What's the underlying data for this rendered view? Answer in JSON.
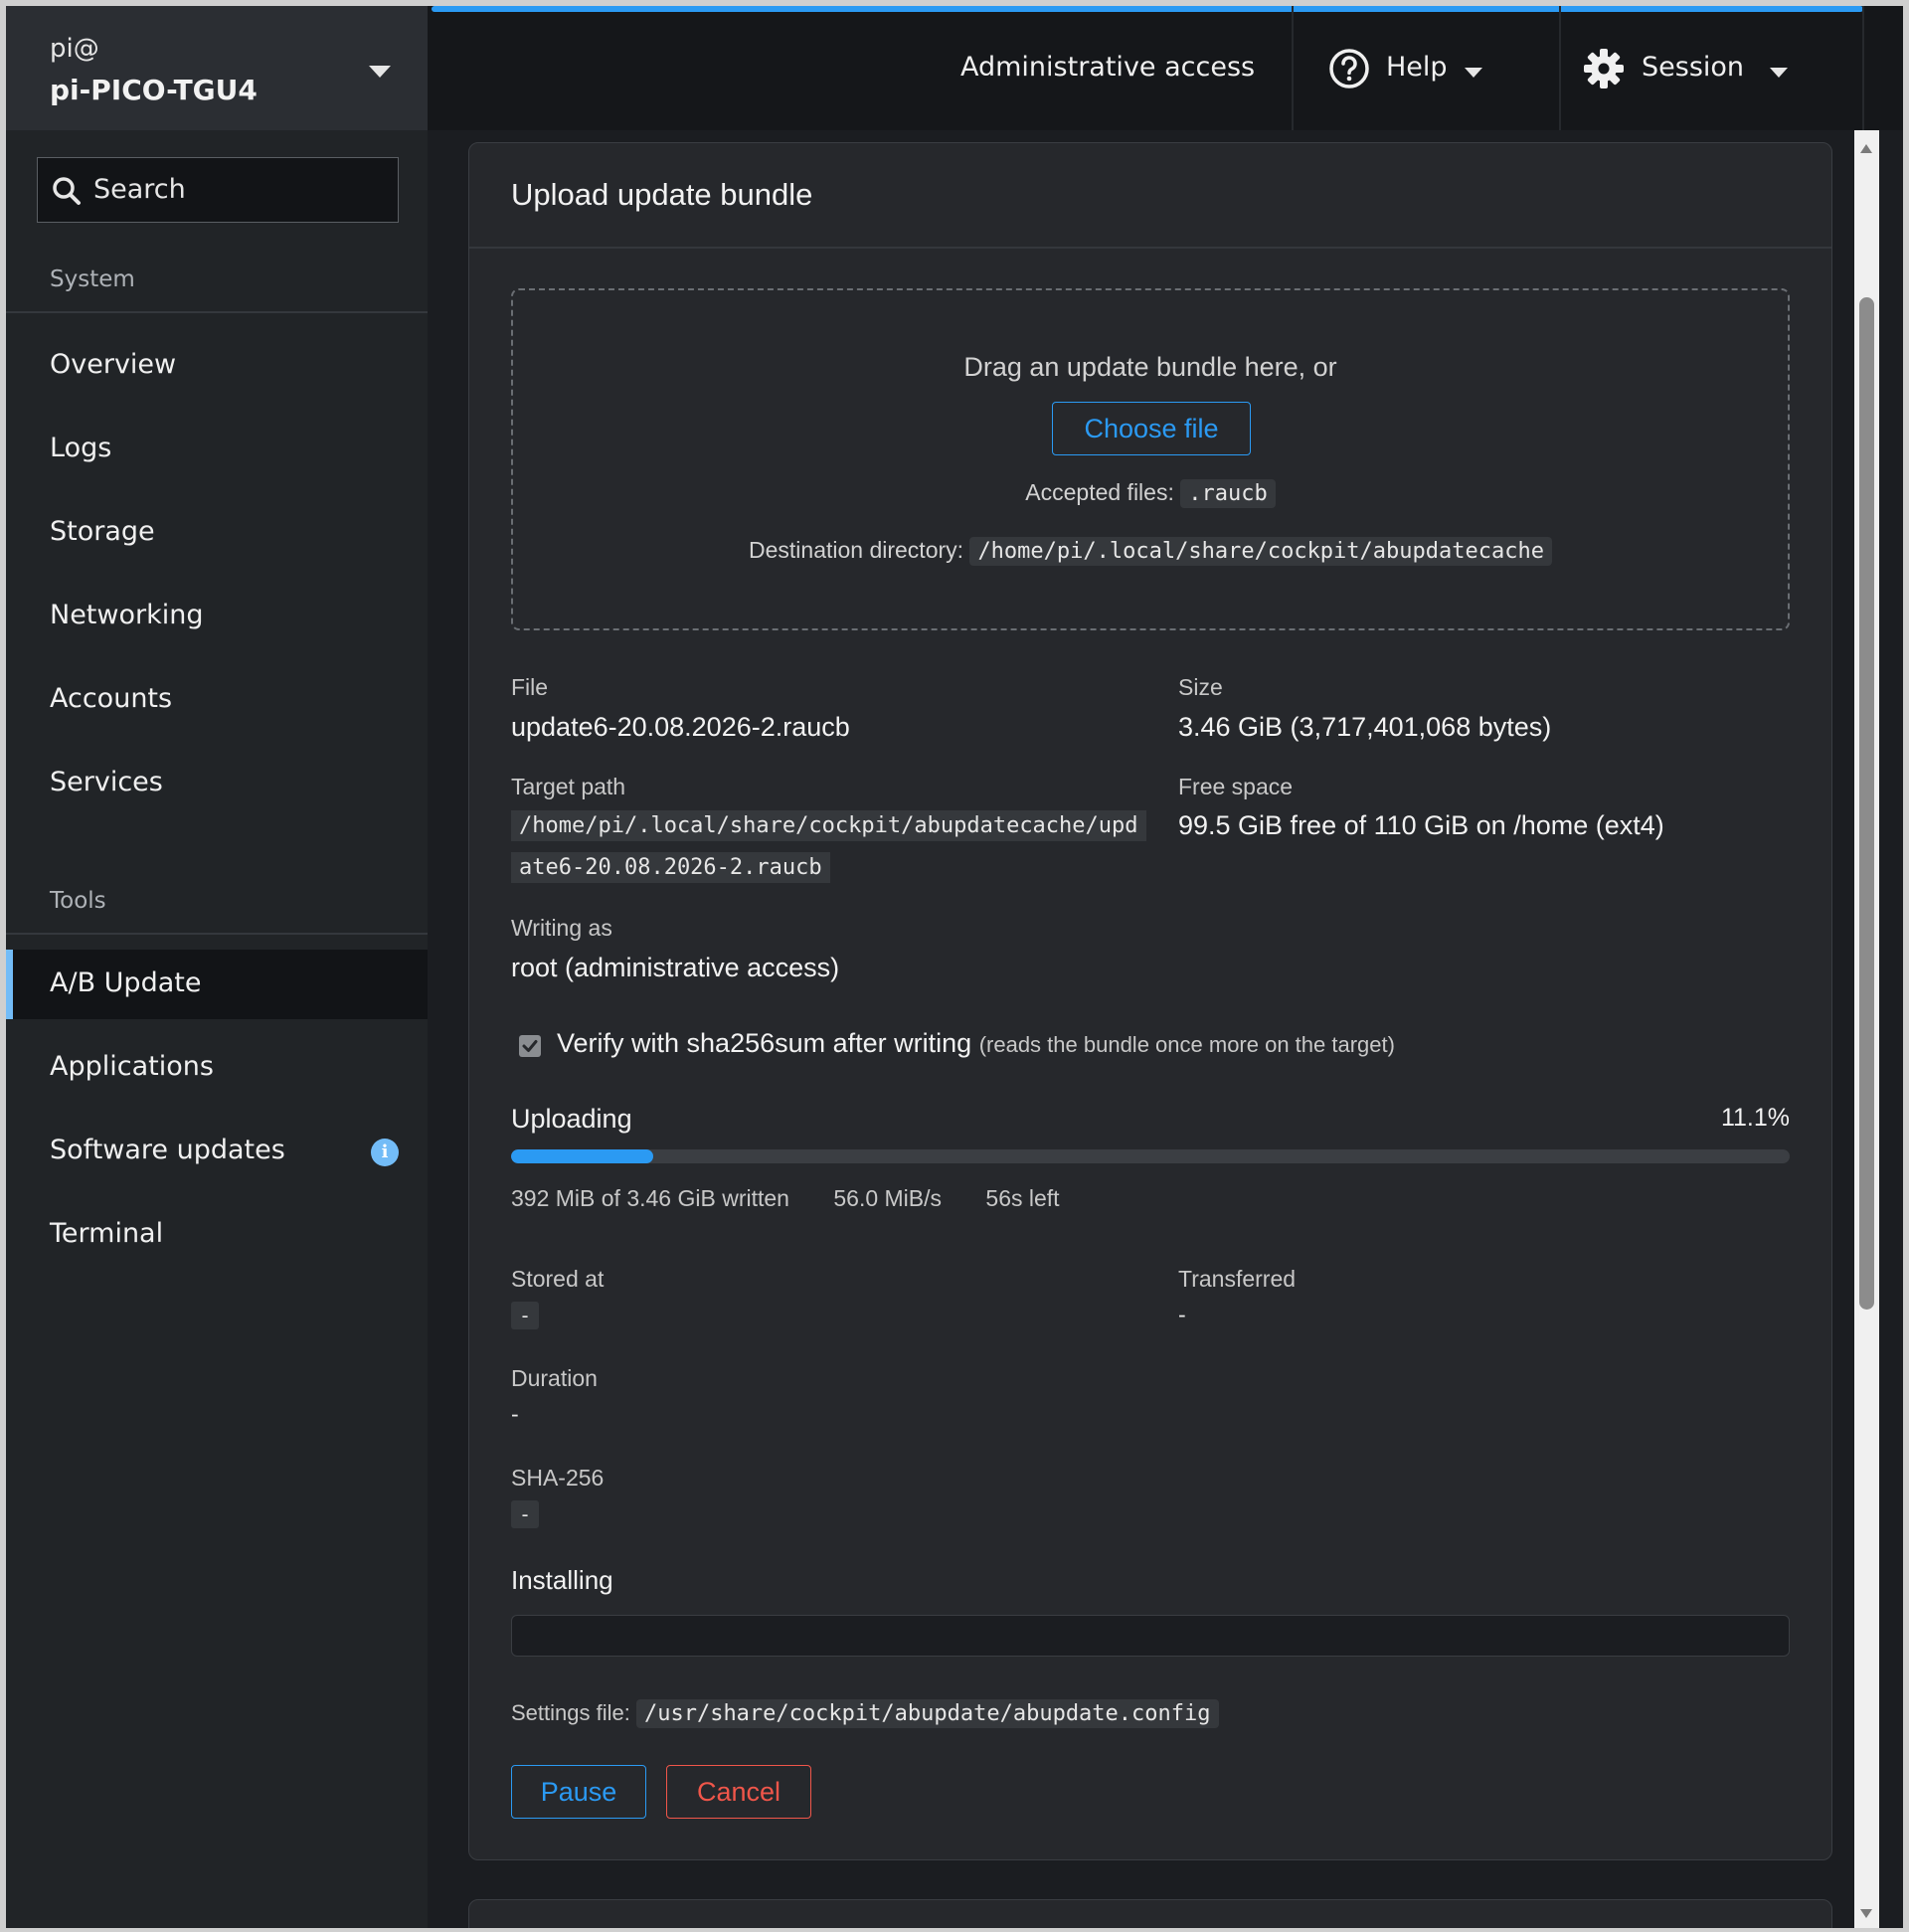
{
  "host": {
    "user": "pi@",
    "name": "pi-PICO-TGU4"
  },
  "search": {
    "label": "Search"
  },
  "sidebar": {
    "system_heading": "System",
    "system_items": [
      {
        "label": "Overview"
      },
      {
        "label": "Logs"
      },
      {
        "label": "Storage"
      },
      {
        "label": "Networking"
      },
      {
        "label": "Accounts"
      },
      {
        "label": "Services"
      }
    ],
    "tools_heading": "Tools",
    "tools_items": [
      {
        "label": "A/B Update",
        "active": true
      },
      {
        "label": "Applications"
      },
      {
        "label": "Software updates",
        "badge": "i"
      },
      {
        "label": "Terminal"
      }
    ]
  },
  "topbar": {
    "admin_label": "Administrative access",
    "help_label": "Help",
    "session_label": "Session",
    "icons": [
      "help-circle-icon",
      "gear-icon",
      "chevron-down-icon"
    ]
  },
  "upload": {
    "title": "Upload update bundle",
    "dropzone": {
      "text": "Drag an update bundle here, or",
      "choose_label": "Choose file",
      "accepted_label": "Accepted files:",
      "accepted_value": ".raucb",
      "destination_label": "Destination directory:",
      "destination_value": "/home/pi/.local/share/cockpit/abupdatecache"
    },
    "fields": {
      "file_label": "File",
      "file_value": "update6-20.08.2026-2.raucb",
      "size_label": "Size",
      "size_value": "3.46 GiB (3,717,401,068 bytes)",
      "target_label": "Target path",
      "target_value": "/home/pi/.local/share/cockpit/abupdatecache/update6-20.08.2026-2.raucb",
      "free_label": "Free space",
      "free_value": "99.5 GiB free of 110 GiB on /home (ext4)",
      "writing_label": "Writing as",
      "writing_value": "root (administrative access)"
    },
    "verify": {
      "checked": true,
      "label": "Verify with sha256sum after writing",
      "note": "(reads the bundle once more on the target)"
    },
    "progress": {
      "title": "Uploading",
      "percent_text": "11.1%",
      "fraction": 0.111,
      "written": "392 MiB of 3.46 GiB written",
      "rate": "56.0 MiB/s",
      "remaining": "56s left",
      "color": "#2b9af3"
    },
    "results": {
      "stored_label": "Stored at",
      "stored_value": "-",
      "transferred_label": "Transferred",
      "transferred_value": "-",
      "duration_label": "Duration",
      "duration_value": "-",
      "sha_label": "SHA-256",
      "sha_value": "-"
    },
    "installing": {
      "title": "Installing"
    },
    "settings": {
      "label": "Settings file:",
      "value": "/usr/share/cockpit/abupdate/abupdate.config"
    },
    "buttons": {
      "pause": "Pause",
      "cancel": "Cancel"
    }
  },
  "colors": {
    "accent": "#2b9af3",
    "danger": "#f0564a",
    "badge": "#73bcf7"
  }
}
